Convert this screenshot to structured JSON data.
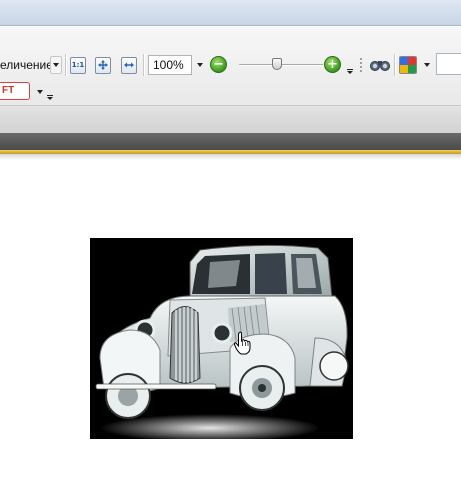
{
  "toolbar": {
    "zoom_mode_label": "еличение",
    "actual_size_label": "1:1",
    "zoom_value": "100%",
    "zoom_out_symbol": "−",
    "zoom_in_symbol": "+",
    "zoom_slider_level": 0.45
  },
  "toolbar2": {
    "ft_label": "FT"
  },
  "icons": {
    "zoom_mode_dropdown": "chevron-down-icon",
    "actual_size": "actual-size-icon",
    "fit_page": "fit-page-icon",
    "fit_width": "fit-width-icon",
    "zoom_dropdown": "chevron-down-icon",
    "zoom_out": "zoom-out-icon",
    "zoom_in": "zoom-in-icon",
    "binoculars": "binoculars-icon",
    "google": "google-icon",
    "hand_cursor": "hand-cursor-icon"
  },
  "colors": {
    "accent_green": "#3a9a1e",
    "gold_line": "#d9ad2e",
    "dark_band": "#555555",
    "ft_red": "#d0342c"
  },
  "document": {
    "image_alt_visible": ""
  }
}
